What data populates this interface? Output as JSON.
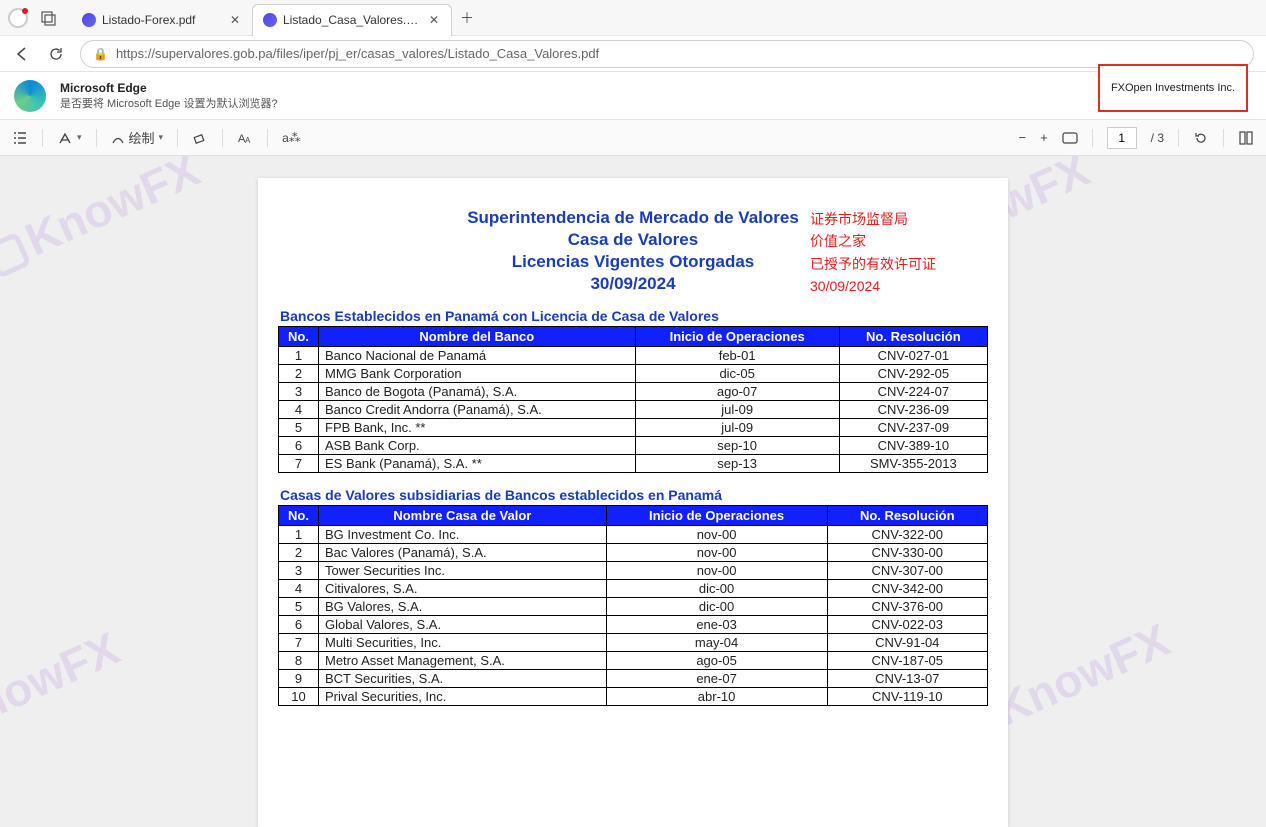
{
  "tabs": [
    {
      "label": "Listado-Forex.pdf",
      "active": false
    },
    {
      "label": "Listado_Casa_Valores.pdf",
      "active": true
    }
  ],
  "url": "https://supervalores.gob.pa/files/iper/pj_er/casas_valores/Listado_Casa_Valores.pdf",
  "edge_prompt": {
    "title": "Microsoft Edge",
    "subtitle": "是否要将 Microsoft Edge 设置为默认浏览器?"
  },
  "callout": "FXOpen Investments Inc.",
  "pdf_toolbar": {
    "draw": "绘制",
    "page_current": "1",
    "page_total": "/ 3"
  },
  "document": {
    "title_lines": [
      "Superintendencia de Mercado de Valores",
      "Casa de Valores",
      "Licencias  Vigentes Otorgadas",
      "30/09/2024"
    ],
    "red_annotations": [
      "证券市场监督局",
      "价值之家",
      "已授予的有效许可证",
      "30/09/2024"
    ],
    "section1": {
      "heading": "Bancos Establecidos en Panamá con Licencia de Casa de Valores",
      "headers": [
        "No.",
        "Nombre del Banco",
        "Inicio de Operaciones",
        "No. Resolución"
      ],
      "rows": [
        [
          "1",
          "Banco Nacional de Panamá",
          "feb-01",
          "CNV-027-01"
        ],
        [
          "2",
          "MMG Bank Corporation",
          "dic-05",
          "CNV-292-05"
        ],
        [
          "3",
          "Banco de Bogota (Panamá), S.A.",
          "ago-07",
          "CNV-224-07"
        ],
        [
          "4",
          "Banco Credit Andorra (Panamá), S.A.",
          "jul-09",
          "CNV-236-09"
        ],
        [
          "5",
          "FPB Bank, Inc. **",
          "jul-09",
          "CNV-237-09"
        ],
        [
          "6",
          "ASB Bank Corp.",
          "sep-10",
          "CNV-389-10"
        ],
        [
          "7",
          "ES Bank (Panamá), S.A. **",
          "sep-13",
          "SMV-355-2013"
        ]
      ]
    },
    "section2": {
      "heading": "Casas de Valores  subsidiarias  de Bancos establecidos en Panamá",
      "headers": [
        "No.",
        "Nombre Casa de Valor",
        "Inicio de Operaciones",
        "No. Resolución"
      ],
      "rows": [
        [
          "1",
          "BG Investment Co. Inc.",
          "nov-00",
          "CNV-322-00"
        ],
        [
          "2",
          "Bac Valores (Panamá), S.A.",
          "nov-00",
          "CNV-330-00"
        ],
        [
          "3",
          "Tower Securities Inc.",
          "nov-00",
          "CNV-307-00"
        ],
        [
          "4",
          "Citivalores, S.A.",
          "dic-00",
          "CNV-342-00"
        ],
        [
          "5",
          "BG Valores, S.A.",
          "dic-00",
          "CNV-376-00"
        ],
        [
          "6",
          "Global Valores, S.A.",
          "ene-03",
          "CNV-022-03"
        ],
        [
          "7",
          "Multi Securities, Inc.",
          "may-04",
          "CNV-91-04"
        ],
        [
          "8",
          "Metro Asset Management, S.A.",
          "ago-05",
          "CNV-187-05"
        ],
        [
          "9",
          "BCT Securities, S.A.",
          "ene-07",
          "CNV-13-07"
        ],
        [
          "10",
          "Prival Securities, Inc.",
          "abr-10",
          "CNV-119-10"
        ]
      ]
    }
  },
  "watermark": "KnowFX"
}
